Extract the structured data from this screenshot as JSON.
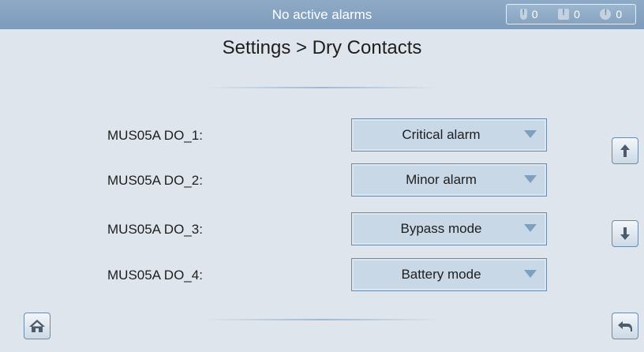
{
  "status_bar": {
    "message": "No active alarms",
    "alarm_counts": {
      "critical": "0",
      "major": "0",
      "minor": "0"
    }
  },
  "page_title": "Settings > Dry Contacts",
  "rows": [
    {
      "label": "MUS05A DO_1:",
      "value": "Critical alarm"
    },
    {
      "label": "MUS05A DO_2:",
      "value": "Minor alarm"
    },
    {
      "label": "MUS05A DO_3:",
      "value": "Bypass mode"
    },
    {
      "label": "MUS05A DO_4:",
      "value": "Battery mode"
    }
  ],
  "icons": {
    "scroll_up": "arrow-up-icon",
    "scroll_down": "arrow-down-icon",
    "home": "home-icon",
    "back": "back-arrow-icon",
    "dropdown": "caret-down-icon"
  },
  "colors": {
    "topbar": "#8eaac6",
    "background": "#dfe5ec",
    "dropdown_fill": "#c9d8e7",
    "caret": "#7f9fbf"
  }
}
